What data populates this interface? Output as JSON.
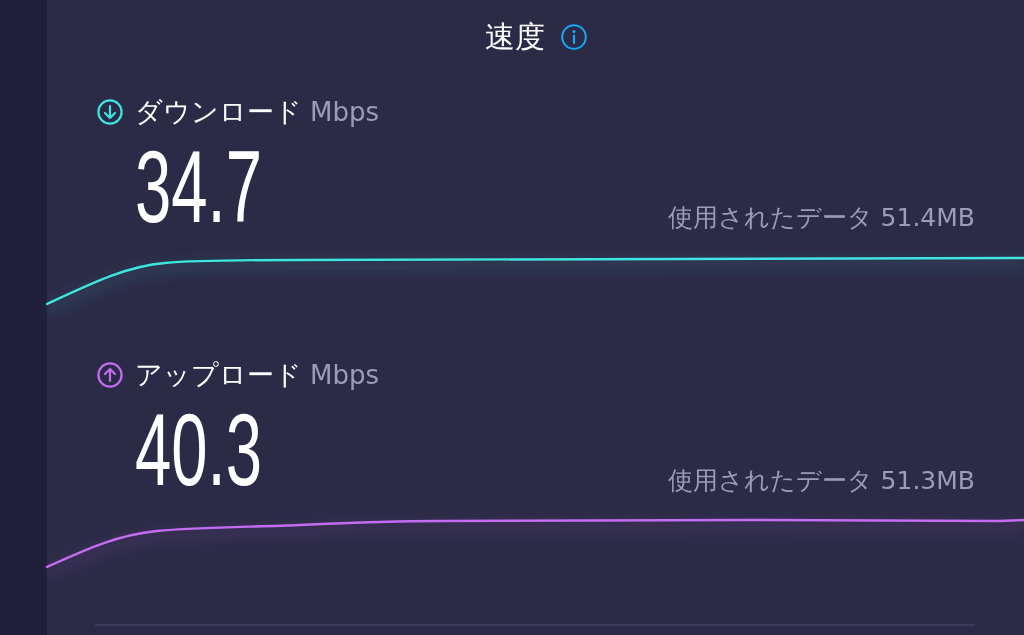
{
  "title": "速度",
  "metrics": [
    {
      "kind": "download",
      "label": "ダウンロード",
      "unit": "Mbps",
      "value": "34.7",
      "data_used": "使用されたデータ 51.4MB",
      "color": "#3ee6e0"
    },
    {
      "kind": "upload",
      "label": "アップロード",
      "unit": "Mbps",
      "value": "40.3",
      "data_used": "使用されたデータ 51.3MB",
      "color": "#c46cf2"
    }
  ]
}
